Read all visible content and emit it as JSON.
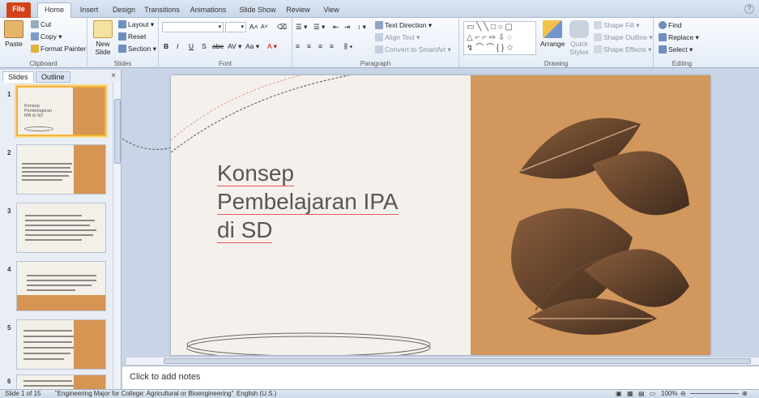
{
  "tabs": [
    "File",
    "Home",
    "Insert",
    "Design",
    "Transitions",
    "Animations",
    "Slide Show",
    "Review",
    "View"
  ],
  "ribbon": {
    "clipboard": {
      "paste": "Paste",
      "cut": "Cut",
      "copy": "Copy",
      "format_painter": "Format Painter",
      "label": "Clipboard"
    },
    "slides": {
      "new_slide": "New",
      "new_slide2": "Slide",
      "layout": "Layout",
      "reset": "Reset",
      "section": "Section",
      "label": "Slides"
    },
    "font": {
      "label": "Font",
      "bold": "B",
      "italic": "I",
      "underline": "U",
      "shadow": "S",
      "strike": "abe",
      "spacing": "AV",
      "case": "Aa",
      "color": "A",
      "grow": "A",
      "shrink": "A"
    },
    "paragraph": {
      "label": "Paragraph",
      "text_direction": "Text Direction",
      "align_text": "Align Text",
      "smartart": "Convert to SmartArt"
    },
    "drawing": {
      "label": "Drawing",
      "arrange": "Arrange",
      "quick_styles": "Quick",
      "quick_styles2": "Styles",
      "shape_fill": "Shape Fill",
      "shape_outline": "Shape Outline",
      "shape_effects": "Shape Effects"
    },
    "editing": {
      "label": "Editing",
      "find": "Find",
      "replace": "Replace",
      "select": "Select"
    }
  },
  "left_pane": {
    "tab_slides": "Slides",
    "tab_outline": "Outline",
    "close": "×",
    "thumbs": [
      {
        "num": "1",
        "title": "Konsep Pembelajaran IPA di SD"
      },
      {
        "num": "2"
      },
      {
        "num": "3"
      },
      {
        "num": "4"
      },
      {
        "num": "5"
      },
      {
        "num": "6"
      }
    ]
  },
  "slide": {
    "title_line1": "Konsep",
    "title_line2": "Pembelajaran IPA",
    "title_line3": "di SD"
  },
  "notes_placeholder": "Click to add notes",
  "status": {
    "slide_info": "Slide 1 of 15",
    "theme": "\"Engineering Major for College: Agricultural or Bioengineering\"",
    "language": "English (U.S.)",
    "zoom": "100%"
  },
  "colors": {
    "file_tab": "#d2431a",
    "slide_right": "#d2975c",
    "slide_bg": "#f4f1ec"
  }
}
